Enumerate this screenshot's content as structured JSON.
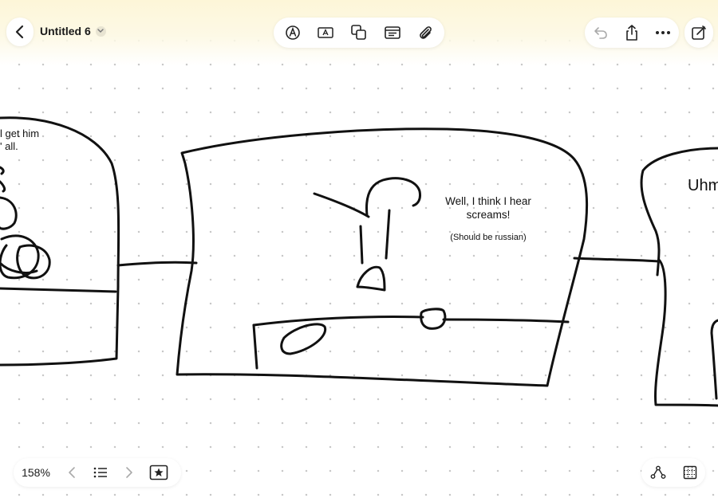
{
  "header": {
    "title": "Untitled 6"
  },
  "toolbar": {
    "tools": [
      "pen-tool-icon",
      "text-box-icon",
      "shapes-icon",
      "media-icon",
      "attachment-icon"
    ],
    "right": [
      "undo-icon",
      "share-icon",
      "more-icon"
    ],
    "compose": "compose-icon"
  },
  "canvas": {
    "left_panel_text": [
      "l get him",
      "' all."
    ],
    "middle_panel_text": [
      "Well, I think I hear",
      "screams!"
    ],
    "middle_panel_note": "(Should be russian)",
    "right_panel_text": "Uhm"
  },
  "footer": {
    "zoom": "158%",
    "icons": [
      "chevron-left-icon",
      "list-icon",
      "chevron-right-icon",
      "star-box-icon",
      "connectors-icon",
      "grid-icon"
    ]
  },
  "colors": {
    "header_bg": "#fdf6d8",
    "ink": "#111111",
    "dot_grid": "#c8c8c8"
  }
}
